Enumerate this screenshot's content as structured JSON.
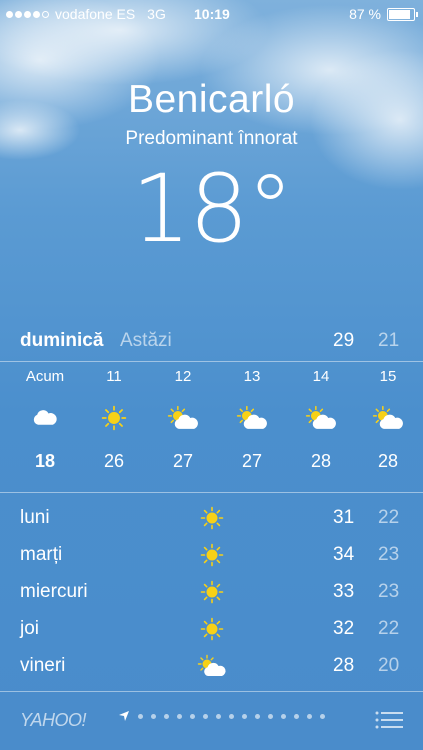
{
  "status_bar": {
    "carrier": "vodafone ES",
    "network": "3G",
    "time": "10:19",
    "battery": "87 %",
    "battery_level": 0.87,
    "signal_bars": 4
  },
  "city": "Benicarló",
  "condition": "Predominant înnorat",
  "current_temp": "18°",
  "today": {
    "day": "duminică",
    "label": "Astăzi",
    "high": "29",
    "low": "21"
  },
  "hourly": [
    {
      "time": "Acum",
      "icon": "cloud-icon",
      "temp": "18"
    },
    {
      "time": "11",
      "icon": "sun-icon",
      "temp": "26"
    },
    {
      "time": "12",
      "icon": "partly-sunny-icon",
      "temp": "27"
    },
    {
      "time": "13",
      "icon": "partly-sunny-icon",
      "temp": "27"
    },
    {
      "time": "14",
      "icon": "partly-sunny-icon",
      "temp": "28"
    },
    {
      "time": "15",
      "icon": "partly-sunny-icon",
      "temp": "28"
    }
  ],
  "daily": [
    {
      "day": "luni",
      "icon": "sun-icon",
      "high": "31",
      "low": "22"
    },
    {
      "day": "marți",
      "icon": "sun-icon",
      "high": "34",
      "low": "23"
    },
    {
      "day": "miercuri",
      "icon": "sun-icon",
      "high": "33",
      "low": "23"
    },
    {
      "day": "joi",
      "icon": "sun-icon",
      "high": "32",
      "low": "22"
    },
    {
      "day": "vineri",
      "icon": "partly-sunny-icon",
      "high": "28",
      "low": "20"
    }
  ],
  "footer": {
    "provider": "YAHOO!",
    "page_dots": 15,
    "current_location_icon": "location-arrow-icon",
    "list_icon": "list-icon"
  },
  "colors": {
    "sky_top": "#7fb1dc",
    "sky_bottom": "#4a8ccb",
    "sun": "#f7d117"
  }
}
